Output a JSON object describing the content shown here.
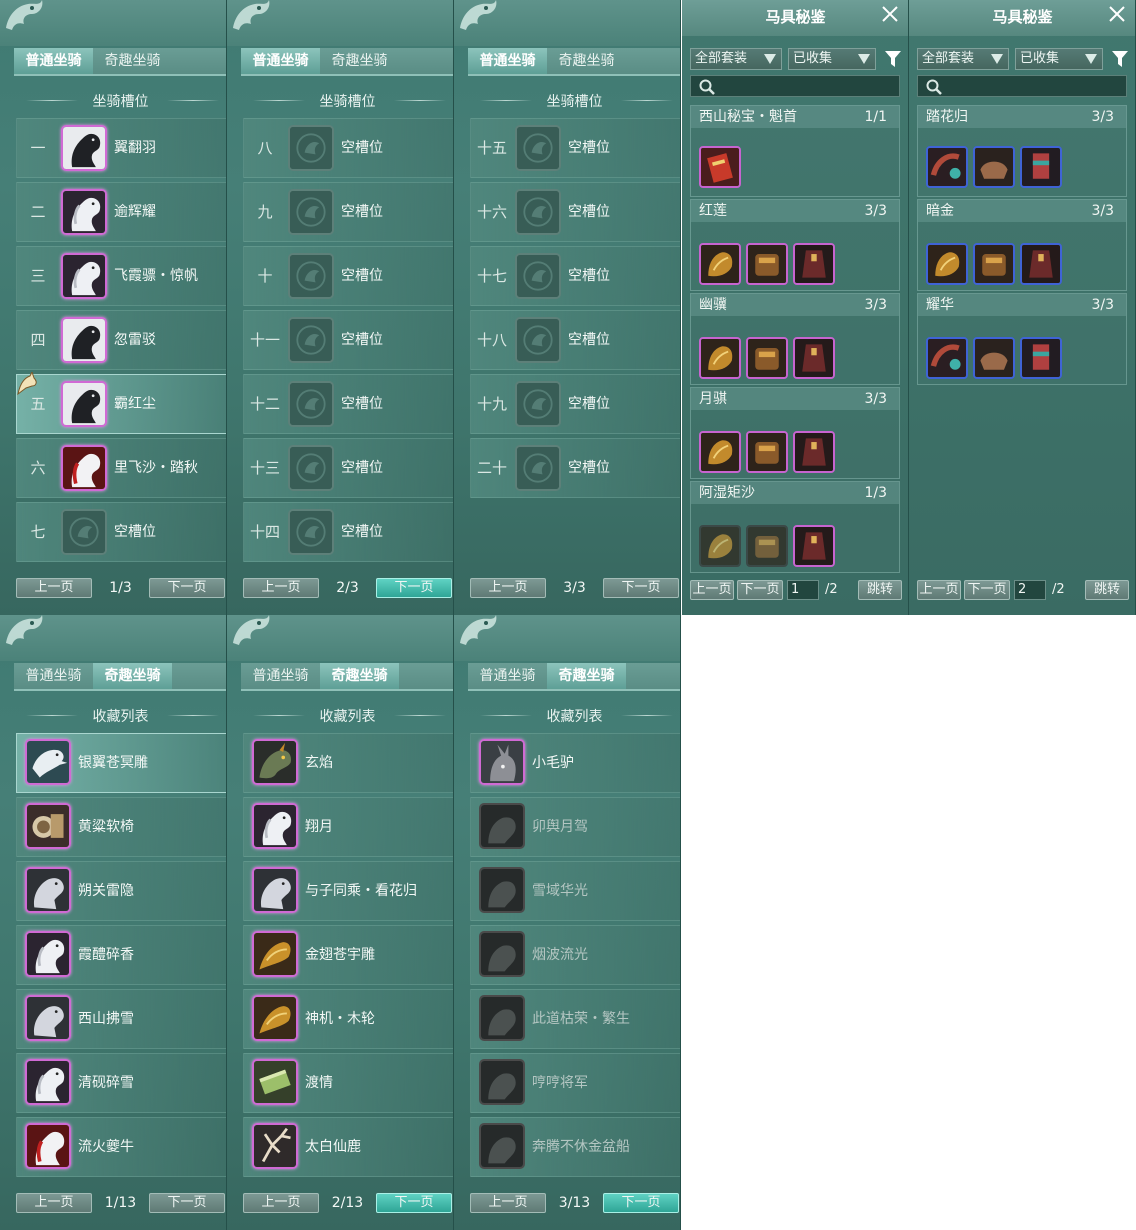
{
  "tabs": {
    "normal": "普通坐骑",
    "fun": "奇趣坐骑"
  },
  "sections": {
    "slots": "坐骑槽位",
    "collection": "收藏列表"
  },
  "pager": {
    "prev": "上一页",
    "next": "下一页"
  },
  "slot_panels": [
    {
      "page": "1/3",
      "rows": [
        {
          "num": "一",
          "name": "翼翻羽"
        },
        {
          "num": "二",
          "name": "逾辉耀"
        },
        {
          "num": "三",
          "name": "飞霞骠・惊帆"
        },
        {
          "num": "四",
          "name": "忽雷驳"
        },
        {
          "num": "五",
          "name": "霸红尘"
        },
        {
          "num": "六",
          "name": "里飞沙・踏秋"
        },
        {
          "num": "七",
          "name": "空槽位"
        }
      ]
    },
    {
      "page": "2/3",
      "rows": [
        {
          "num": "八",
          "name": "空槽位"
        },
        {
          "num": "九",
          "name": "空槽位"
        },
        {
          "num": "十",
          "name": "空槽位"
        },
        {
          "num": "十一",
          "name": "空槽位"
        },
        {
          "num": "十二",
          "name": "空槽位"
        },
        {
          "num": "十三",
          "name": "空槽位"
        },
        {
          "num": "十四",
          "name": "空槽位"
        }
      ]
    },
    {
      "page": "3/3",
      "rows": [
        {
          "num": "十五",
          "name": "空槽位"
        },
        {
          "num": "十六",
          "name": "空槽位"
        },
        {
          "num": "十七",
          "name": "空槽位"
        },
        {
          "num": "十八",
          "name": "空槽位"
        },
        {
          "num": "十九",
          "name": "空槽位"
        },
        {
          "num": "二十",
          "name": "空槽位"
        }
      ]
    }
  ],
  "collection_panels": [
    {
      "page": "1/13",
      "items": [
        "银翼苍冥雕",
        "黄粱软椅",
        "朔关雷隐",
        "霞醴碎香",
        "西山拂雪",
        "清砚碎雪",
        "流火夔牛"
      ]
    },
    {
      "page": "2/13",
      "items": [
        "玄焰",
        "翔月",
        "与子同乘・看花归",
        "金翅苍宇雕",
        "神机・木轮",
        "渡情",
        "太白仙鹿"
      ]
    },
    {
      "page": "3/13",
      "items": [
        "小毛驴",
        "卯舆月驾",
        "雪域华光",
        "烟波流光",
        "此道枯荣・繁生",
        "哼哼将军",
        "奔腾不休金盆船"
      ]
    }
  ],
  "saddle_panels": [
    {
      "title": "马具秘鉴",
      "filter_all": "全部套装",
      "filter_collected": "已收集",
      "page_input": "1",
      "total": "/2",
      "jump": "跳转",
      "sets": [
        {
          "name": "西山秘宝・魁首",
          "count": "1/1"
        },
        {
          "name": "红莲",
          "count": "3/3"
        },
        {
          "name": "幽骥",
          "count": "3/3"
        },
        {
          "name": "月骐",
          "count": "3/3"
        },
        {
          "name": "阿湿矩沙",
          "count": "1/3"
        }
      ]
    },
    {
      "title": "马具秘鉴",
      "filter_all": "全部套装",
      "filter_collected": "已收集",
      "page_input": "2",
      "total": "/2",
      "jump": "跳转",
      "sets": [
        {
          "name": "踏花归",
          "count": "3/3"
        },
        {
          "name": "暗金",
          "count": "3/3"
        },
        {
          "name": "耀华",
          "count": "3/3"
        }
      ]
    }
  ],
  "colors": {
    "accent": "#2fa596",
    "rare_border": "#c764d0",
    "epic_border": "#3f63d6",
    "panel_bg": "#467f77"
  },
  "icons": [
    "dragon-ornament-icon",
    "horse-cursor-icon",
    "close-icon",
    "filter-icon",
    "search-icon",
    "dropdown-arrow-icon"
  ]
}
